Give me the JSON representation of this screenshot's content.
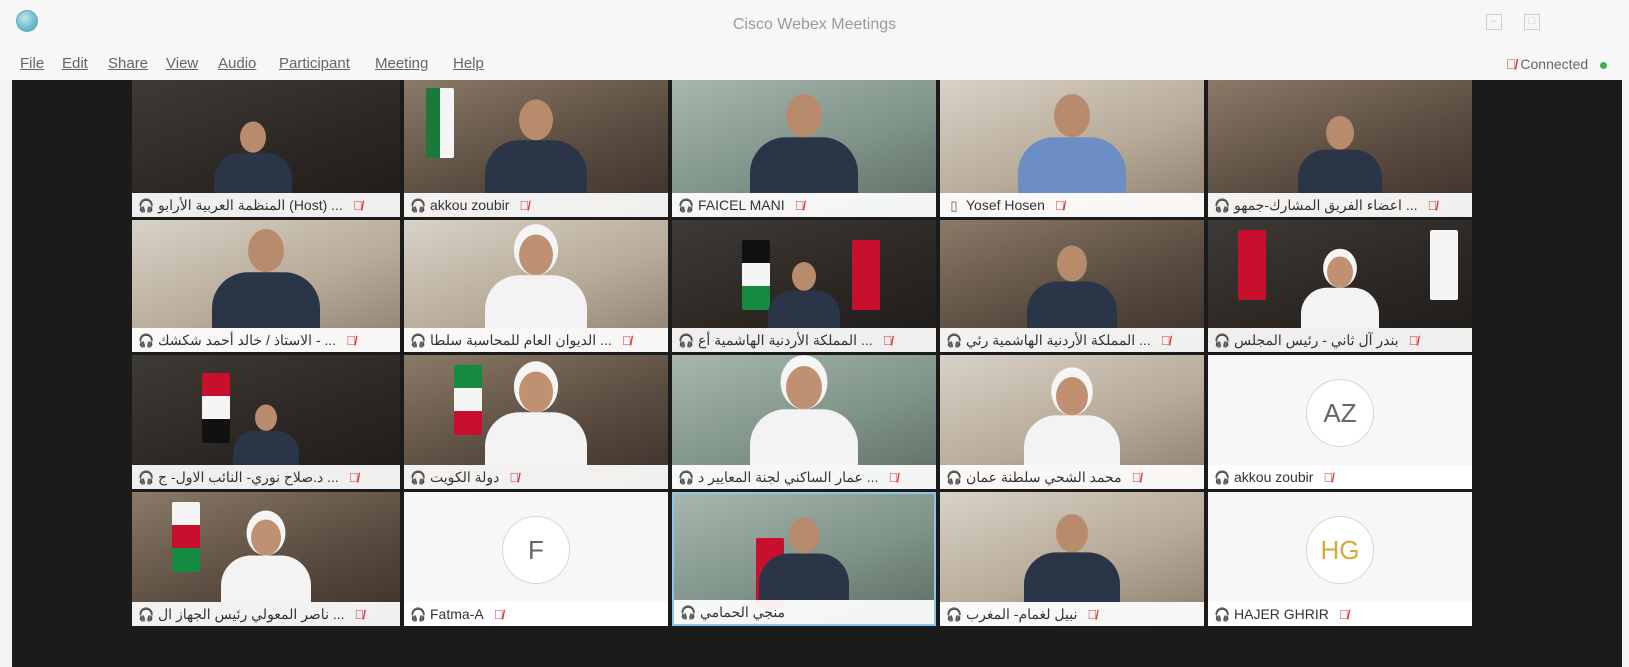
{
  "window": {
    "title": "Cisco Webex Meetings"
  },
  "menu": {
    "items": [
      "File",
      "Edit",
      "Share",
      "View",
      "Audio",
      "Participant",
      "Meeting",
      "Help"
    ]
  },
  "status": {
    "connected": "Connected"
  },
  "tiles": [
    {
      "name": "المنظمة العربية الأرابو (Host) ...",
      "type": "video"
    },
    {
      "name": "akkou zoubir",
      "type": "video"
    },
    {
      "name": "FAICEL MANI",
      "type": "video"
    },
    {
      "name": "Yosef Hosen",
      "type": "video"
    },
    {
      "name": "اعضاء الفريق المشارك-جمهو ...",
      "type": "video"
    },
    {
      "name": "الاستاذ / خالد أحمد شكشك - ...",
      "type": "video"
    },
    {
      "name": "الديوان العام للمحاسبة سلطا ...",
      "type": "video"
    },
    {
      "name": "المملكة الأردنية الهاشمية أع ...",
      "type": "video"
    },
    {
      "name": "المملكة الأردنية الهاشمية رئي ...",
      "type": "video"
    },
    {
      "name": "بندر آل ثاني - رئيس المجلس",
      "type": "video"
    },
    {
      "name": "د.صلاح نوري- النائب الاول- ج ...",
      "type": "video"
    },
    {
      "name": "دولة الكويت",
      "type": "video"
    },
    {
      "name": "عمار الساكني لجنة المعايير د ...",
      "type": "video"
    },
    {
      "name": "محمد الشحي سلطنة عمان",
      "type": "video"
    },
    {
      "name": "akkou zoubir",
      "type": "avatar",
      "initials": "AZ"
    },
    {
      "name": "ناصر المعولي رئيس الجهاز ال ...",
      "type": "video"
    },
    {
      "name": "Fatma-A",
      "type": "avatar",
      "initials": "F"
    },
    {
      "name": "منجي الحمامي",
      "type": "video"
    },
    {
      "name": "نبيل لغمام- المغرب",
      "type": "video"
    },
    {
      "name": "HAJER GHRIR",
      "type": "avatar",
      "initials": "HG"
    }
  ]
}
